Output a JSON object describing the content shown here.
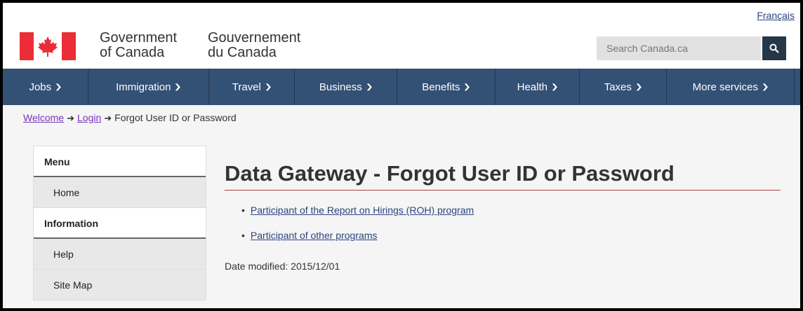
{
  "header": {
    "lang_link": "Français",
    "signature_en": [
      "Government",
      "of Canada"
    ],
    "signature_fr": [
      "Gouvernement",
      "du Canada"
    ],
    "search_placeholder": "Search Canada.ca",
    "brand_red": "#eb2d37",
    "search_button_color": "#26374a"
  },
  "nav": {
    "color": "#335075",
    "items": [
      "Jobs",
      "Immigration",
      "Travel",
      "Business",
      "Benefits",
      "Health",
      "Taxes",
      "More services"
    ]
  },
  "breadcrumb": {
    "items": [
      "Welcome",
      "Login",
      "Forgot User ID or Password"
    ]
  },
  "sidebar": {
    "heading1": "Menu",
    "item_home": "Home",
    "heading2": "Information",
    "item_help": "Help",
    "item_sitemap": "Site Map"
  },
  "main": {
    "title": "Data Gateway - Forgot User ID or Password",
    "links": [
      "Participant of the Report on Hirings (ROH) program",
      "Participant of other programs"
    ],
    "date_modified": "Date modified: 2015/12/01"
  }
}
